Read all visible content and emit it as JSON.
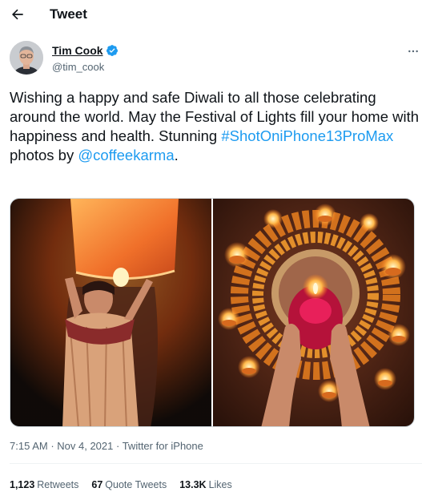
{
  "header": {
    "title": "Tweet",
    "back_icon": "arrow-left-icon"
  },
  "author": {
    "display_name": "Tim Cook",
    "handle": "@tim_cook",
    "verified_icon": "verified-badge-icon",
    "verified_color": "#1d9bf0"
  },
  "more_icon": "more-dots-icon",
  "tweet": {
    "text_1": "Wishing a happy and safe Diwali to all those celebrating around the world. May the Festival of Lights fill your home with happiness and health. Stunning ",
    "hashtag": "#ShotOniPhone13ProMax",
    "text_2": " photos by ",
    "mention": "@coffeekarma",
    "text_3": "."
  },
  "media": [
    {
      "description_icon": "photo-sky-lantern"
    },
    {
      "description_icon": "photo-diya-flowers"
    }
  ],
  "meta": {
    "time": "7:15 AM",
    "sep1": " · ",
    "date": "Nov 4, 2021",
    "sep2": " · ",
    "source": "Twitter for iPhone"
  },
  "stats": {
    "retweets_count": "1,123",
    "retweets_label": "Retweets",
    "quotes_count": "67",
    "quotes_label": "Quote Tweets",
    "likes_count": "13.3K",
    "likes_label": "Likes"
  },
  "colors": {
    "link": "#1d9bf0",
    "text": "#0f1419",
    "secondary": "#536471",
    "border": "#eff3f4"
  }
}
